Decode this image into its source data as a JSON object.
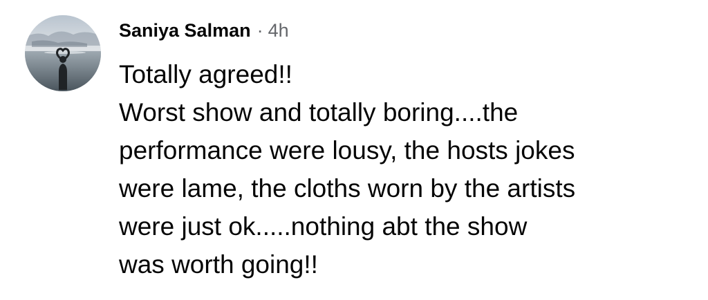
{
  "comment": {
    "author": "Saniya Salman",
    "separator": "·",
    "time": "4h",
    "avatar_icon": "profile-photo-icon",
    "lines": [
      "Totally agreed!!",
      "Worst show and totally boring....the",
      "performance were lousy, the hosts jokes",
      "were lame, the cloths worn by the artists",
      "were just ok.....nothing abt the show",
      "was worth going!!"
    ]
  },
  "colors": {
    "text": "#050505",
    "secondary": "#65676b",
    "background": "#ffffff"
  }
}
